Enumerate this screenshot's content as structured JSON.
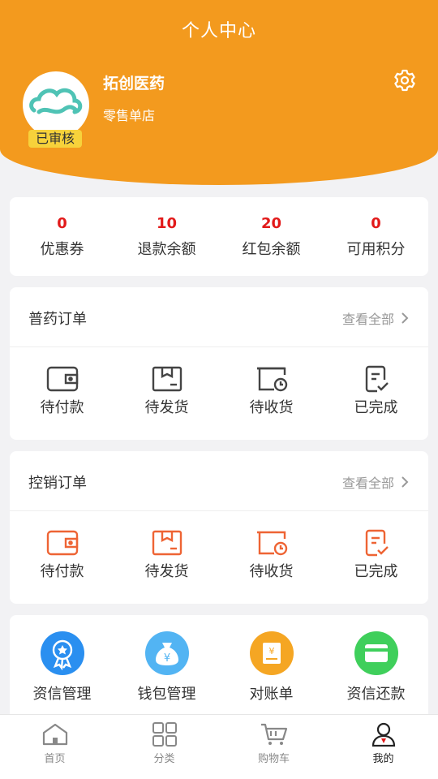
{
  "header": {
    "title": "个人中心",
    "store_name": "拓创医药",
    "store_type": "零售单店",
    "badge": "已审核",
    "brand_color": "#f39a1e"
  },
  "stats": [
    {
      "value": "0",
      "label": "优惠券"
    },
    {
      "value": "10",
      "label": "退款余额"
    },
    {
      "value": "20",
      "label": "红包余额"
    },
    {
      "value": "0",
      "label": "可用积分"
    }
  ],
  "orders_general": {
    "title": "普药订单",
    "view_all": "查看全部",
    "icon_color": "#444444",
    "items": [
      {
        "label": "待付款",
        "icon": "wallet-icon"
      },
      {
        "label": "待发货",
        "icon": "package-icon"
      },
      {
        "label": "待收货",
        "icon": "truck-clock-icon"
      },
      {
        "label": "已完成",
        "icon": "checklist-icon"
      }
    ]
  },
  "orders_controlled": {
    "title": "控销订单",
    "view_all": "查看全部",
    "icon_color": "#ee6434",
    "items": [
      {
        "label": "待付款",
        "icon": "wallet-icon"
      },
      {
        "label": "待发货",
        "icon": "package-icon"
      },
      {
        "label": "待收货",
        "icon": "truck-clock-icon"
      },
      {
        "label": "已完成",
        "icon": "checklist-icon"
      }
    ]
  },
  "tools": [
    {
      "label": "资信管理",
      "icon": "credit-badge-icon",
      "color": "#2a8ff0"
    },
    {
      "label": "钱包管理",
      "icon": "money-bag-icon",
      "color": "#52b4f3"
    },
    {
      "label": "对账单",
      "icon": "statement-icon",
      "color": "#f5a623"
    },
    {
      "label": "资信还款",
      "icon": "card-icon",
      "color": "#3fcf5b"
    }
  ],
  "tabbar": [
    {
      "label": "首页",
      "icon": "home-icon",
      "active": false
    },
    {
      "label": "分类",
      "icon": "grid-icon",
      "active": false
    },
    {
      "label": "购物车",
      "icon": "cart-icon",
      "active": false
    },
    {
      "label": "我的",
      "icon": "user-icon",
      "active": true
    }
  ]
}
